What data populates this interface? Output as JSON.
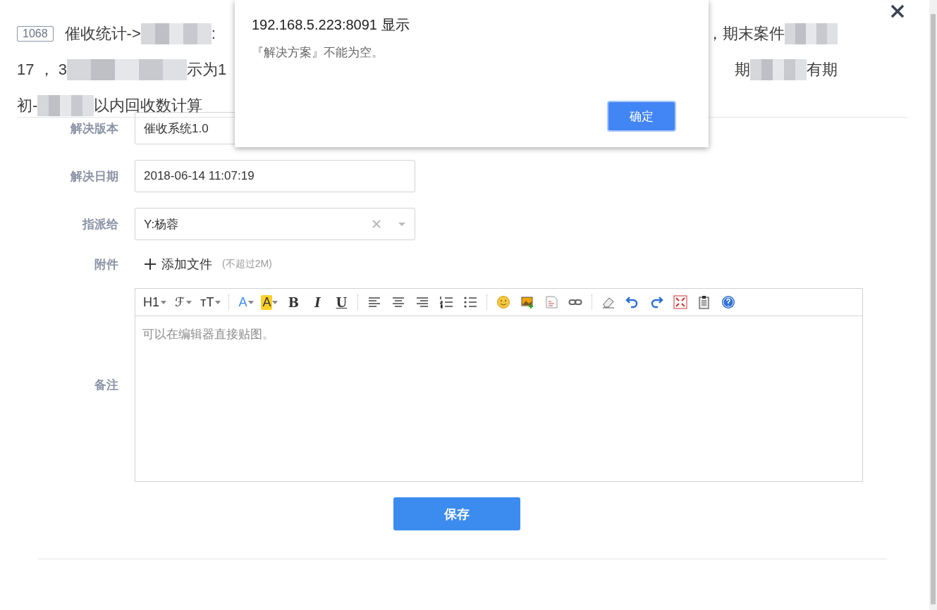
{
  "header": {
    "badge": "1068",
    "lines": [
      {
        "left": [
          {
            "kind": "text",
            "text": "催收统计->"
          },
          {
            "kind": "redacted"
          },
          {
            "kind": "text",
            "text": ":"
          }
        ],
        "right": [
          {
            "kind": "text",
            "text": "，期末案件"
          },
          {
            "kind": "redacted"
          }
        ]
      },
      {
        "left": [
          {
            "kind": "text",
            "text": "17 ， 3"
          },
          {
            "kind": "redacted"
          },
          {
            "kind": "text",
            "text": "示为1"
          }
        ],
        "right": [
          {
            "kind": "text",
            "text": "期"
          },
          {
            "kind": "redacted"
          },
          {
            "kind": "text",
            "text": "有期"
          }
        ]
      },
      {
        "left": [
          {
            "kind": "text",
            "text": "初-"
          },
          {
            "kind": "redacted"
          },
          {
            "kind": "text",
            "text": "以内回收数计算"
          }
        ]
      }
    ]
  },
  "form": {
    "version": {
      "label": "解决版本",
      "value": "催收系统1.0"
    },
    "date": {
      "label": "解决日期",
      "value": "2018-06-14 11:07:19"
    },
    "assignee": {
      "label": "指派给",
      "value": "Y:杨蓉"
    },
    "attachment": {
      "label": "附件",
      "button": "添加文件",
      "hint": "(不超过2M)"
    },
    "notes": {
      "label": "备注",
      "placeholder": "可以在编辑器直接贴图。",
      "toolbar": [
        {
          "kind": "glyph",
          "label": "H1"
        },
        {
          "kind": "glyph",
          "label": "ℱ"
        },
        {
          "kind": "glyph",
          "label": "ᴛT"
        },
        {
          "kind": "divider"
        },
        {
          "kind": "glyph",
          "label": "A"
        },
        {
          "kind": "glyph",
          "label": "A"
        },
        {
          "kind": "glyph",
          "label": "B"
        },
        {
          "kind": "glyph",
          "label": "I"
        },
        {
          "kind": "glyph",
          "label": "U"
        },
        {
          "kind": "divider"
        },
        {
          "kind": "icon"
        },
        {
          "kind": "icon"
        },
        {
          "kind": "icon"
        },
        {
          "kind": "icon"
        },
        {
          "kind": "icon"
        },
        {
          "kind": "divider"
        },
        {
          "kind": "icon"
        },
        {
          "kind": "icon"
        },
        {
          "kind": "icon"
        },
        {
          "kind": "icon"
        },
        {
          "kind": "divider"
        },
        {
          "kind": "icon"
        },
        {
          "kind": "icon"
        },
        {
          "kind": "icon"
        },
        {
          "kind": "icon"
        },
        {
          "kind": "icon"
        },
        {
          "kind": "icon"
        }
      ]
    },
    "save": "保存"
  },
  "dialog": {
    "title": "192.168.5.223:8091 显示",
    "message": "『解决方案』不能为空。",
    "ok": "确定"
  }
}
